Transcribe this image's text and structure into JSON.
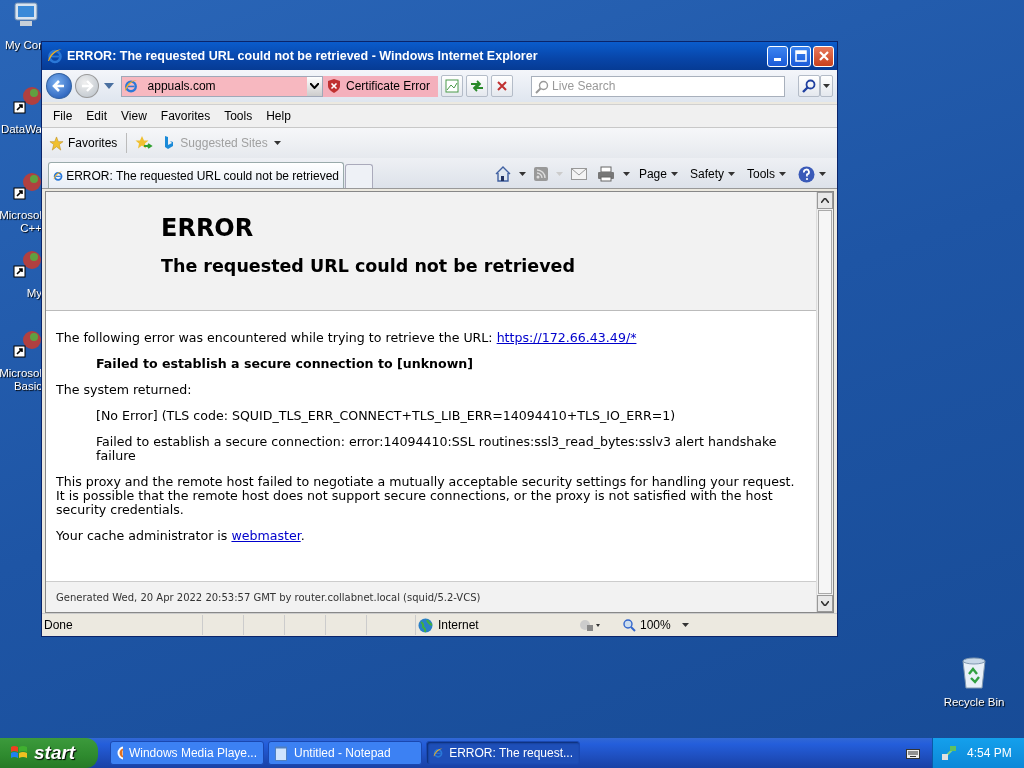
{
  "desktop": {
    "icons": [
      {
        "kind": "computer",
        "lines": [
          "My Cor"
        ]
      },
      {
        "kind": "shortcut",
        "lines": [
          "DataWa"
        ]
      },
      {
        "kind": "shortcut",
        "lines": [
          "Microsol",
          "C++"
        ]
      },
      {
        "kind": "shortcut",
        "lines": [
          "My"
        ]
      },
      {
        "kind": "shortcut",
        "lines": [
          "Microsol",
          "Basic"
        ]
      }
    ],
    "recycle_bin": "Recycle Bin"
  },
  "window": {
    "title": "ERROR: The requested URL could not be retrieved - Windows Internet Explorer",
    "address": "appuals.com",
    "certificate": "Certificate Error",
    "search": {
      "placeholder": "Live Search"
    },
    "menu": [
      "File",
      "Edit",
      "View",
      "Favorites",
      "Tools",
      "Help"
    ],
    "favorites": {
      "label": "Favorites",
      "suggested": "Suggested Sites"
    },
    "tabs": [
      {
        "label": "ERROR: The requested URL could not be retrieved",
        "selected": true
      }
    ],
    "commands": [
      "Page",
      "Safety",
      "Tools"
    ]
  },
  "page": {
    "heading": "ERROR",
    "subheading": "The requested URL could not be retrieved",
    "intro": {
      "text": "The following error was encountered while trying to retrieve the URL: ",
      "link": "https://172.66.43.49/*"
    },
    "failure": "Failed to establish a secure connection to [unknown]",
    "returned_label": "The system returned:",
    "returned": [
      "[No Error] (TLS code: SQUID_TLS_ERR_CONNECT+TLS_LIB_ERR=14094410+TLS_IO_ERR=1)",
      "Failed to establish a secure connection: error:14094410:SSL routines:ssl3_read_bytes:sslv3 alert handshake failure"
    ],
    "explanation": "This proxy and the remote host failed to negotiate a mutually acceptable security settings for handling your request. It is possible that the remote host does not support secure connections, or the proxy is not satisfied with the host security credentials.",
    "admin": {
      "text": "Your cache administrator is ",
      "link": "webmaster",
      "after": "."
    },
    "footer": "Generated Wed, 20 Apr 2022 20:53:57 GMT by router.collabnet.local (squid/5.2-VCS)"
  },
  "status_bar": {
    "text": "Done",
    "zone": "Internet",
    "zoom": "100%"
  },
  "taskbar": {
    "start": "start",
    "items": [
      {
        "kind": "media",
        "label": "Windows Media Playe...",
        "selected": false
      },
      {
        "kind": "notepad",
        "label": "Untitled - Notepad",
        "selected": false
      },
      {
        "kind": "browser",
        "label": "ERROR: The request...",
        "selected": true
      }
    ],
    "clock": "4:54 PM"
  }
}
